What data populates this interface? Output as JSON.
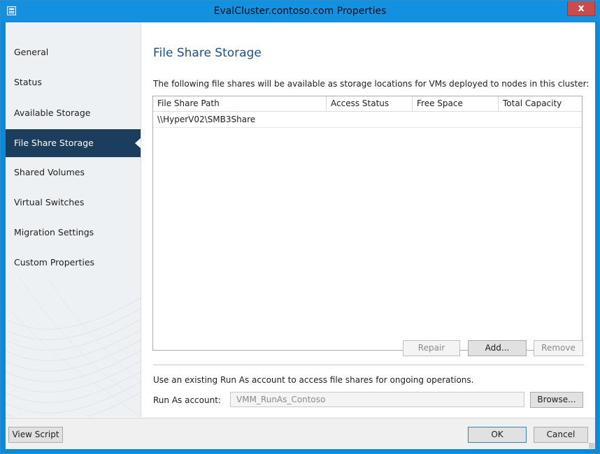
{
  "window": {
    "title": "EvalCluster.contoso.com Properties",
    "close_glyph": "x",
    "accent_color": "#1391e0",
    "close_color": "#c94c4c"
  },
  "sidebar": {
    "items": [
      {
        "label": "General"
      },
      {
        "label": "Status"
      },
      {
        "label": "Available Storage"
      },
      {
        "label": "File Share Storage",
        "active": true
      },
      {
        "label": "Shared Volumes"
      },
      {
        "label": "Virtual Switches"
      },
      {
        "label": "Migration Settings"
      },
      {
        "label": "Custom Properties"
      }
    ],
    "active_color": "#1c3e5e"
  },
  "main": {
    "heading": "File Share Storage",
    "description": "The following file shares will be available as storage locations for VMs deployed to nodes in this cluster:",
    "table": {
      "columns": [
        "File Share Path",
        "Access Status",
        "Free Space",
        "Total Capacity"
      ],
      "rows": [
        [
          "\\\\HyperV02\\SMB3Share",
          "",
          "",
          ""
        ]
      ]
    },
    "buttons": {
      "repair": "Repair",
      "add": "Add...",
      "remove": "Remove"
    },
    "runas": {
      "description": "Use an existing Run As account to access file shares for ongoing operations.",
      "label": "Run As account:",
      "value": "VMM_RunAs_Contoso",
      "browse": "Browse..."
    }
  },
  "footer": {
    "view_script": "View Script",
    "ok": "OK",
    "cancel": "Cancel"
  }
}
